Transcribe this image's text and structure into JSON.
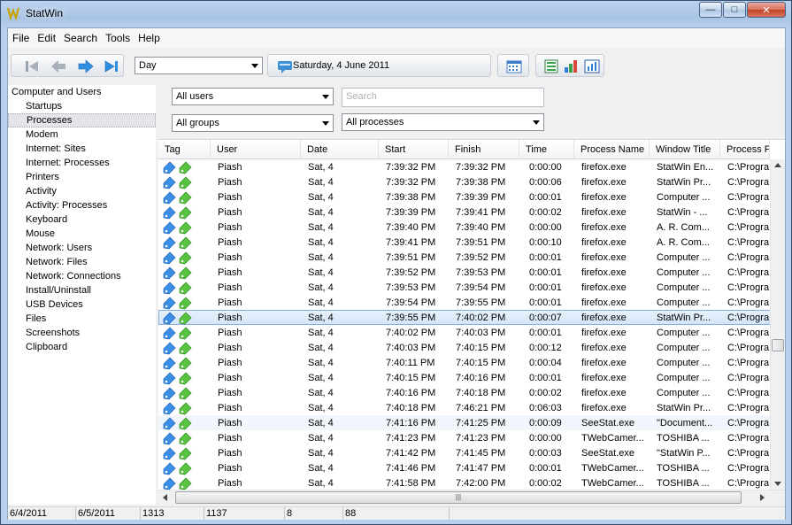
{
  "window": {
    "title": "StatWin"
  },
  "menu": [
    "File",
    "Edit",
    "Search",
    "Tools",
    "Help"
  ],
  "toolbar": {
    "period_value": "Day",
    "date_label": "Saturday, 4 June 2011"
  },
  "sidebar": {
    "root": "Computer and Users",
    "items": [
      "Startups",
      "Processes",
      "Modem",
      "Internet: Sites",
      "Internet: Processes",
      "Printers",
      "Activity",
      "Activity: Processes",
      "Keyboard",
      "Mouse",
      "Network: Users",
      "Network: Files",
      "Network: Connections",
      "Install/Uninstall",
      "USB Devices",
      "Files",
      "Screenshots",
      "Clipboard"
    ],
    "selected_index": 1
  },
  "filters": {
    "users": "All users",
    "groups": "All groups",
    "search_placeholder": "Search",
    "processes": "All processes"
  },
  "table": {
    "columns": [
      "Tag",
      "User",
      "Date",
      "Start",
      "Finish",
      "Time",
      "Process Name",
      "Window Title",
      "Process Pat"
    ],
    "selected_row": 10,
    "hover_row": 17,
    "rows": [
      [
        "Piash",
        "Sat, 4",
        "7:39:32 PM",
        "7:39:32 PM",
        "0:00:00",
        "firefox.exe",
        "StatWin En...",
        "C:\\Progra..."
      ],
      [
        "Piash",
        "Sat, 4",
        "7:39:32 PM",
        "7:39:38 PM",
        "0:00:06",
        "firefox.exe",
        "StatWin Pr...",
        "C:\\Progra..."
      ],
      [
        "Piash",
        "Sat, 4",
        "7:39:38 PM",
        "7:39:39 PM",
        "0:00:01",
        "firefox.exe",
        "Computer ...",
        "C:\\Progra..."
      ],
      [
        "Piash",
        "Sat, 4",
        "7:39:39 PM",
        "7:39:41 PM",
        "0:00:02",
        "firefox.exe",
        "StatWin - ...",
        "C:\\Progra..."
      ],
      [
        "Piash",
        "Sat, 4",
        "7:39:40 PM",
        "7:39:40 PM",
        "0:00:00",
        "firefox.exe",
        "A. R. Com...",
        "C:\\Progra..."
      ],
      [
        "Piash",
        "Sat, 4",
        "7:39:41 PM",
        "7:39:51 PM",
        "0:00:10",
        "firefox.exe",
        "A. R. Com...",
        "C:\\Progra..."
      ],
      [
        "Piash",
        "Sat, 4",
        "7:39:51 PM",
        "7:39:52 PM",
        "0:00:01",
        "firefox.exe",
        "Computer ...",
        "C:\\Progra..."
      ],
      [
        "Piash",
        "Sat, 4",
        "7:39:52 PM",
        "7:39:53 PM",
        "0:00:01",
        "firefox.exe",
        "Computer ...",
        "C:\\Progra..."
      ],
      [
        "Piash",
        "Sat, 4",
        "7:39:53 PM",
        "7:39:54 PM",
        "0:00:01",
        "firefox.exe",
        "Computer ...",
        "C:\\Progra..."
      ],
      [
        "Piash",
        "Sat, 4",
        "7:39:54 PM",
        "7:39:55 PM",
        "0:00:01",
        "firefox.exe",
        "Computer ...",
        "C:\\Progra..."
      ],
      [
        "Piash",
        "Sat, 4",
        "7:39:55 PM",
        "7:40:02 PM",
        "0:00:07",
        "firefox.exe",
        "StatWin Pr...",
        "C:\\Progra..."
      ],
      [
        "Piash",
        "Sat, 4",
        "7:40:02 PM",
        "7:40:03 PM",
        "0:00:01",
        "firefox.exe",
        "Computer ...",
        "C:\\Progra..."
      ],
      [
        "Piash",
        "Sat, 4",
        "7:40:03 PM",
        "7:40:15 PM",
        "0:00:12",
        "firefox.exe",
        "Computer ...",
        "C:\\Progra..."
      ],
      [
        "Piash",
        "Sat, 4",
        "7:40:11 PM",
        "7:40:15 PM",
        "0:00:04",
        "firefox.exe",
        "Computer ...",
        "C:\\Progra..."
      ],
      [
        "Piash",
        "Sat, 4",
        "7:40:15 PM",
        "7:40:16 PM",
        "0:00:01",
        "firefox.exe",
        "Computer ...",
        "C:\\Progra..."
      ],
      [
        "Piash",
        "Sat, 4",
        "7:40:16 PM",
        "7:40:18 PM",
        "0:00:02",
        "firefox.exe",
        "Computer ...",
        "C:\\Progra..."
      ],
      [
        "Piash",
        "Sat, 4",
        "7:40:18 PM",
        "7:46:21 PM",
        "0:06:03",
        "firefox.exe",
        "StatWin Pr...",
        "C:\\Progra..."
      ],
      [
        "Piash",
        "Sat, 4",
        "7:41:16 PM",
        "7:41:25 PM",
        "0:00:09",
        "SeeStat.exe",
        "\"Document...",
        "C:\\Progra..."
      ],
      [
        "Piash",
        "Sat, 4",
        "7:41:23 PM",
        "7:41:23 PM",
        "0:00:00",
        "TWebCamer...",
        "TOSHIBA ...",
        "C:\\Progra..."
      ],
      [
        "Piash",
        "Sat, 4",
        "7:41:42 PM",
        "7:41:45 PM",
        "0:00:03",
        "SeeStat.exe",
        "\"StatWin P...",
        "C:\\Progra..."
      ],
      [
        "Piash",
        "Sat, 4",
        "7:41:46 PM",
        "7:41:47 PM",
        "0:00:01",
        "TWebCamer...",
        "TOSHIBA ...",
        "C:\\Progra..."
      ],
      [
        "Piash",
        "Sat, 4",
        "7:41:58 PM",
        "7:42:00 PM",
        "0:00:02",
        "TWebCamer...",
        "TOSHIBA ...",
        "C:\\Progra..."
      ]
    ]
  },
  "hscroll_grip": "|||",
  "statusbar": [
    "6/4/2011",
    "6/5/2011",
    "1313",
    "1137",
    "8",
    "88"
  ]
}
